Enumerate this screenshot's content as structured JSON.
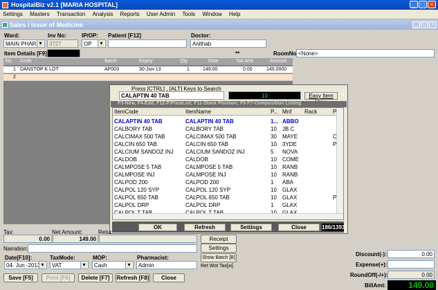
{
  "window": {
    "title": "HospitalBiz v2.1 [MARIA HOSPITAL]"
  },
  "menu": [
    "Settings",
    "Masters",
    "Transaction",
    "Analysis",
    "Reports",
    "User Admin",
    "Tools",
    "Window",
    "Help"
  ],
  "child_title": "Sales / Issue of Medicine",
  "form": {
    "ward_label": "Ward:",
    "ward_value": "MAIN PHARM",
    "inv_label": "Inv No:",
    "inv_value": "3727",
    "ipop_label": "IP/OP:",
    "ipop_value": "OP",
    "patient_label": "Patient [F12]",
    "patient_value": "",
    "doctor_label": "Doctor:",
    "doctor_value": "Anithab",
    "item_details_label": "Item Details [F9]:",
    "stars": "**",
    "roomno_label": "RoomNo:",
    "roomno_value": "<None>"
  },
  "grid": {
    "headers": [
      "No",
      "Code",
      "Batch",
      "Expiry",
      "Qty",
      "Rate",
      "Tax Amt",
      "Amount"
    ],
    "rows": [
      {
        "no": "1",
        "code": "DANSTOP K  LOT",
        "batch": "AP003",
        "expiry": "30-Jun-13",
        "qty": "1",
        "rate": "149.00",
        "tax": "0.00",
        "amount": "149.0000"
      },
      {
        "no": "2",
        "code": "",
        "batch": "",
        "expiry": "",
        "qty": "",
        "rate": "",
        "tax": "",
        "amount": ""
      }
    ]
  },
  "popup": {
    "hint": "Press [CTRL] , [ALT] Keys to Search",
    "search_value": "CALAPTIN 40 TAB",
    "count": "10",
    "easy_view_label": "Easy Item View",
    "shortcut_line": "F3-New, F4-Edit, F12-P.PriceList;  F11-Stock Position; F9  F7-Composition Listing",
    "columns": [
      "ItemCode",
      "ItemName",
      "P...",
      "Mnf",
      "Rack",
      "Pr"
    ],
    "rows": [
      [
        "CALAPTIN 40 TAB",
        "CALAPTIN 40 TAB",
        "1...",
        "ABBO",
        "",
        ""
      ],
      [
        "CALBORY TAB",
        "CALBORY TAB",
        "10",
        "JB C",
        "",
        ""
      ],
      [
        "CALCIMAX 500 TAB",
        "CALCIMAX 500 TAB",
        "30",
        "MAYE",
        "",
        "CA"
      ],
      [
        "CALCIN 650 TAB",
        "CALCIN 650 TAB",
        "10",
        "3YDE",
        "",
        "PA"
      ],
      [
        "CALCIUM SANDOZ INJ",
        "CALCIUM SANDOZ INJ",
        "5",
        "NOVA",
        "",
        ""
      ],
      [
        "CALDOB",
        "CALDOB",
        "10",
        "COME",
        "",
        ""
      ],
      [
        "CALMPOSE 5 TAB",
        "CALMPOSE 5 TAB",
        "10",
        "RANB",
        "",
        ""
      ],
      [
        "CALMPOSE INJ",
        "CALMPOSE INJ",
        "10",
        "RANB",
        "",
        ""
      ],
      [
        "CALPOD 200",
        "CALPOD 200",
        "1",
        "ABA",
        "",
        ""
      ],
      [
        "CALPOL  120 SYP",
        "CALPOL  120 SYP",
        "10",
        "GLAX",
        "",
        ""
      ],
      [
        "CALPOL 650 TAB",
        "CALPOL 650 TAB",
        "10",
        "GLAX",
        "",
        "PA"
      ],
      [
        "CALPOL DRP",
        "CALPOL DRP",
        "1",
        "GLAX",
        "",
        ""
      ],
      [
        "CALPOL T TAB",
        "CALPOL T TAB",
        "10",
        "GLAX",
        "",
        ""
      ]
    ],
    "ok_label": "OK",
    "refresh_label": "Refresh",
    "settings_label": "Settings",
    "close_label": "Close",
    "counter": "186/1393"
  },
  "totals": {
    "tax_label": "Tax:",
    "tax_value": "0.00",
    "net_label": "Net Amount:",
    "net_value": "149.00",
    "retur_label": "Retur",
    "narration_label": "Narration:",
    "date_label": "Date[F10]:",
    "date_value": "04- Jun -2013",
    "taxmode_label": "TaxMode:",
    "taxmode_value": "VAT",
    "mop_label": "MOP:",
    "mop_value": "Cash",
    "pharmacist_label": "Pharmacist:",
    "pharmacist_value": "Admin",
    "receipt_label": "Receipt",
    "settings_label": "Settings",
    "show_batch_label": "Show Batch [B]",
    "ret_wot_label": "Ret Wot Tax[w]",
    "discount_label": "Discount(-):",
    "discount_value": "0.00",
    "expense_label": "Expense(+):",
    "roundoff_label": "RoundOff(-/+):",
    "roundoff_value": "0.00",
    "billamt_label": "BillAmt:",
    "billamt_value": "149.00"
  },
  "buttons": {
    "save": "Save [F5]",
    "print": "Print [F6]",
    "delete": "Delete [F7]",
    "refresh": "Refresh [F8]",
    "close": "Close"
  },
  "colors": {
    "title_blue": "#0a58d8",
    "list_highlight": "#0000cc",
    "billamt_green": "#00c000"
  }
}
